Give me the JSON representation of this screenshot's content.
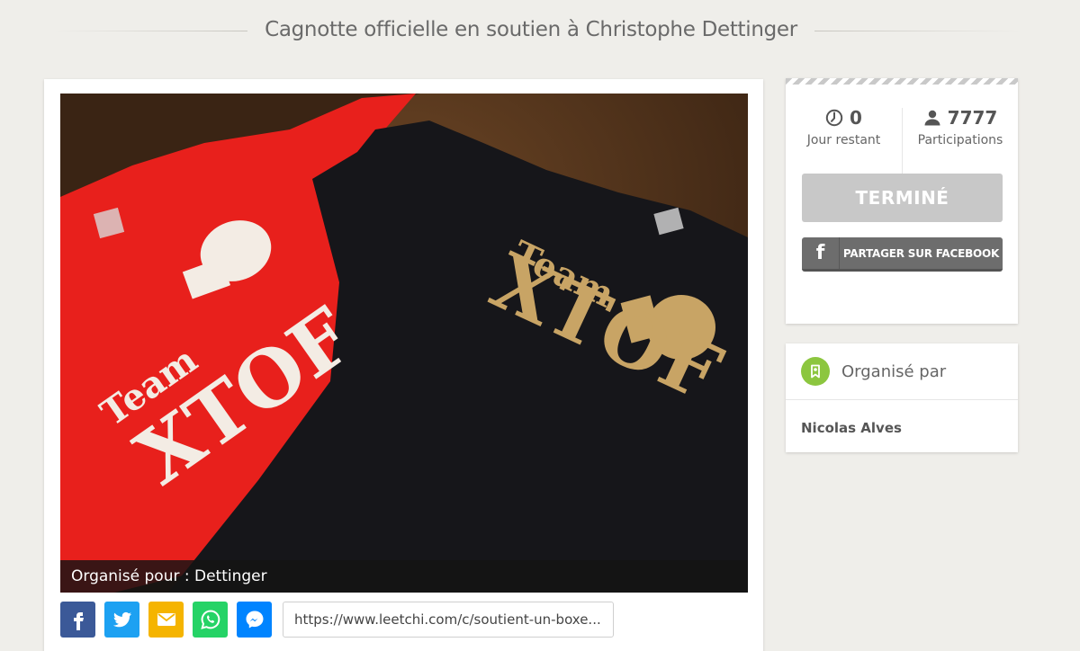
{
  "header": {
    "title": "Cagnotte officielle en soutien à Christophe Dettinger"
  },
  "photo": {
    "caption": "Organisé pour : Dettinger",
    "shirt_left_text_1": "Team",
    "shirt_left_text_2": "XTOF",
    "shirt_right_text_1": "Team",
    "shirt_right_text_2": "XTOF"
  },
  "share": {
    "icons": [
      "facebook-icon",
      "twitter-icon",
      "email-icon",
      "whatsapp-icon",
      "messenger-icon"
    ],
    "url": "https://www.leetchi.com/c/soutient-un-boxe..."
  },
  "stats": {
    "days_value": "0",
    "days_label": "Jour restant",
    "participants_value": "7777",
    "participants_label": "Participations"
  },
  "actions": {
    "status_label": "TERMINÉ",
    "facebook_icon_glyph": "f",
    "facebook_share_label": "PARTAGER SUR FACEBOOK"
  },
  "organizer": {
    "title": "Organisé par",
    "name": "Nicolas Alves"
  },
  "colors": {
    "background": "#efeeea",
    "facebook": "#3b5998",
    "twitter": "#1da1f2",
    "email": "#f5b400",
    "whatsapp": "#25d366",
    "messenger": "#0084ff",
    "organizer_badge": "#8cc63f",
    "shirt_red": "#e8201c",
    "shirt_black": "#16161a",
    "print_gold": "#c8a465"
  }
}
